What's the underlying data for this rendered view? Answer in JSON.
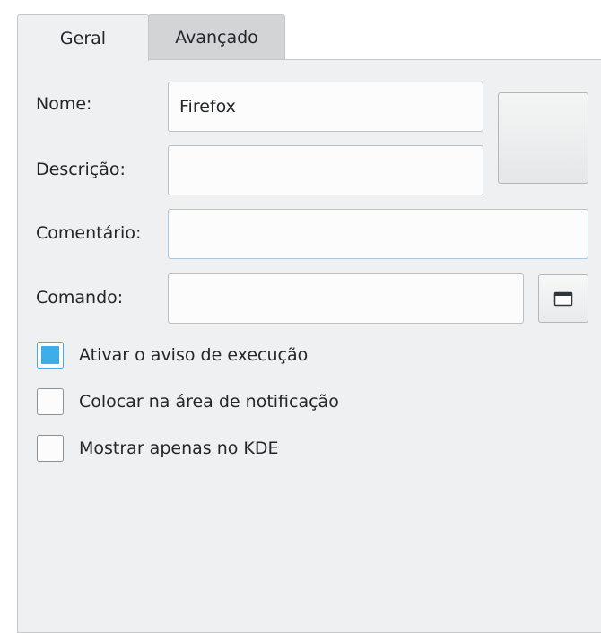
{
  "tabs": {
    "general": "Geral",
    "advanced": "Avançado"
  },
  "form": {
    "name_label": "Nome:",
    "name_value": "Firefox",
    "description_label": "Descrição:",
    "description_value": "",
    "comment_label": "Comentário:",
    "comment_value": "",
    "command_label": "Comando:",
    "command_value": ""
  },
  "options": {
    "launch_feedback": {
      "label": "Ativar o aviso de execução",
      "checked": true
    },
    "system_tray": {
      "label": "Colocar na área de notificação",
      "checked": false
    },
    "kde_only": {
      "label": "Mostrar apenas no KDE",
      "checked": false
    }
  },
  "icons": {
    "app_icon": "application-icon-placeholder",
    "browse": "folder-icon"
  },
  "colors": {
    "accent": "#3daee9",
    "panel_bg": "#eff0f1",
    "inactive_tab_bg": "#d3d4d6"
  }
}
